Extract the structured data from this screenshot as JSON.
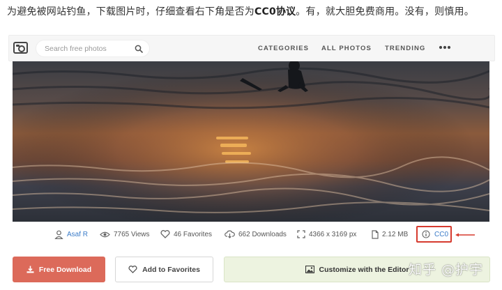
{
  "caption": {
    "part1": "为避免被网站钓鱼，下载图片时，仔细查看右下角是否为",
    "bold": "CC0协议",
    "part2": "。有，就大胆免费商用。没有，则慎用。"
  },
  "navbar": {
    "search_placeholder": "Search free photos",
    "links": [
      "CATEGORIES",
      "ALL PHOTOS",
      "TRENDING"
    ]
  },
  "meta": {
    "author": "Asaf R",
    "views": "7765 Views",
    "favorites": "46 Favorites",
    "downloads": "662 Downloads",
    "dimensions": "4366 x 3169 px",
    "size": "2.12 MB",
    "license": "CC0"
  },
  "actions": {
    "download": "Free Download",
    "favorite": "Add to Favorites",
    "customize": "Customize with the Editor"
  },
  "watermark": "知乎 @护宇",
  "colors": {
    "download_button": "#dc6a5a",
    "link": "#3a7bc8",
    "highlight_box": "#d63a2e",
    "editor_button": "#edf3e0"
  }
}
